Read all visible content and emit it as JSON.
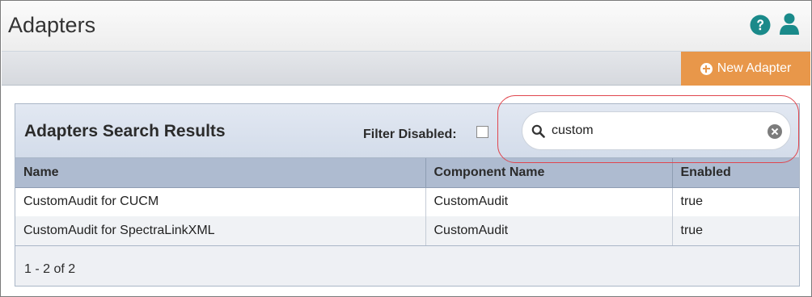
{
  "header": {
    "title": "Adapters",
    "help_icon": "question-circle-icon",
    "user_icon": "user-icon",
    "accent_color": "#1a8a8a"
  },
  "toolbar": {
    "new_adapter_label": "New Adapter",
    "new_adapter_color": "#e8974a"
  },
  "panel": {
    "title": "Adapters Search Results",
    "filter_label": "Filter Disabled:",
    "filter_checked": false,
    "search": {
      "value": "custom",
      "placeholder": ""
    }
  },
  "table": {
    "columns": [
      "Name",
      "Component Name",
      "Enabled"
    ],
    "rows": [
      [
        "CustomAudit for CUCM",
        "CustomAudit",
        "true"
      ],
      [
        "CustomAudit for SpectraLinkXML",
        "CustomAudit",
        "true"
      ]
    ]
  },
  "pager": {
    "text": "1 - 2 of 2"
  }
}
